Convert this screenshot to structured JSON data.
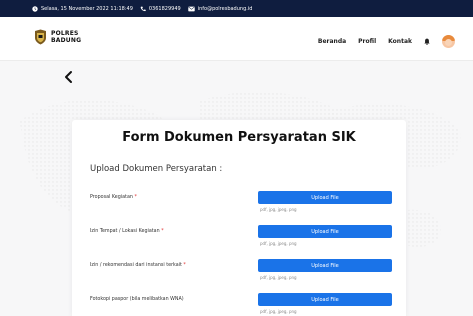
{
  "topbar": {
    "datetime": "Selasa, 15 November 2022 11:18:49",
    "phone": "0361829949",
    "email": "info@polresbadung.id"
  },
  "logo": {
    "line1": "POLRES",
    "line2": "BADUNG"
  },
  "nav": {
    "items": [
      "Beranda",
      "Profil",
      "Kontak"
    ]
  },
  "form": {
    "title": "Form Dokumen Persyaratan SIK",
    "section_title": "Upload Dokumen Persyaratan :",
    "rows": [
      {
        "label": "Proposal Kegiatan",
        "required_mark": "*",
        "button": "Upload File",
        "hint": "pdf, jpg, jpeg, png"
      },
      {
        "label": "Izin Tempat / Lokasi Kegiatan",
        "required_mark": "*",
        "button": "Upload File",
        "hint": "pdf, jpg, jpeg, png"
      },
      {
        "label": "Izin / rekomendasi dari instansi terkait",
        "required_mark": "*",
        "button": "Upload File",
        "hint": "pdf, jpg, jpeg, png"
      },
      {
        "label": "Fotokopi paspor (bila melibatkan WNA)",
        "required_mark": "",
        "button": "Upload File",
        "hint": "pdf, jpg, jpeg, png"
      }
    ]
  },
  "colors": {
    "topbar": "#0f1d3f",
    "accent": "#1a73e8",
    "required": "#e03131"
  }
}
